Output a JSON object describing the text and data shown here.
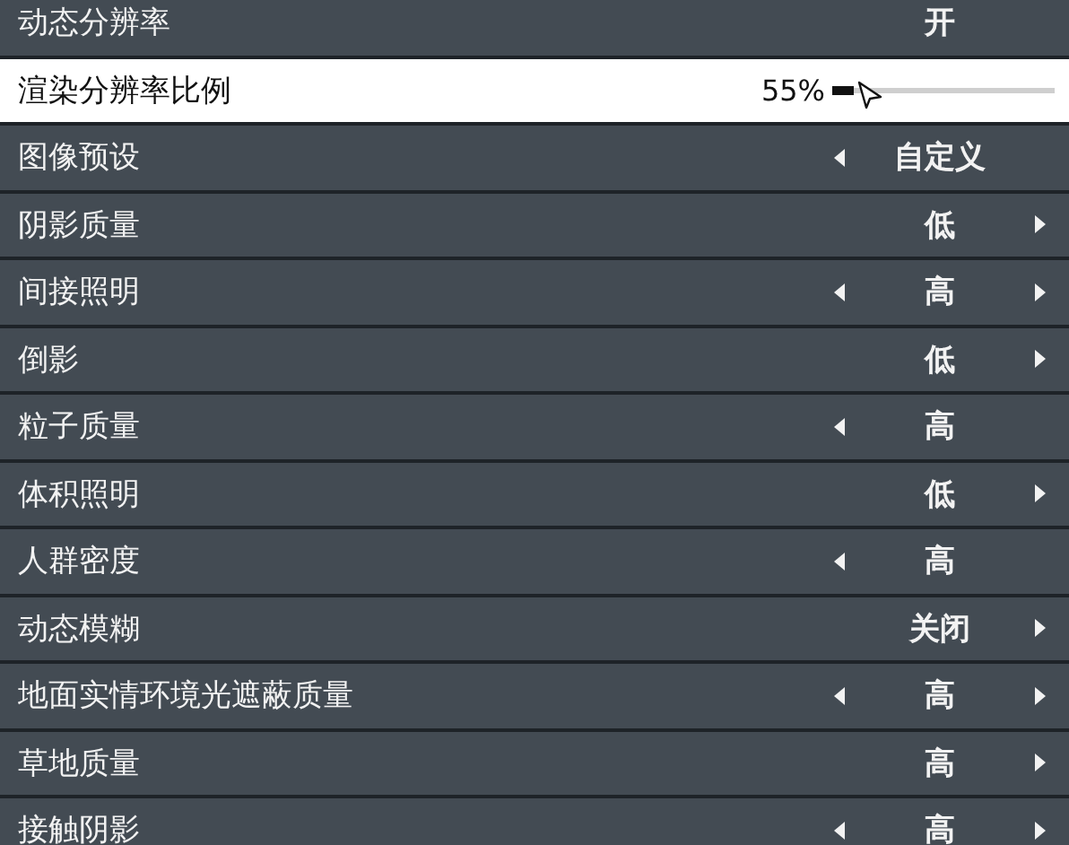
{
  "settings": [
    {
      "kind": "choice",
      "label": "动态分辨率",
      "value": "开",
      "selected": false,
      "left_arrow": false,
      "right_arrow": false
    },
    {
      "kind": "slider",
      "label": "渲染分辨率比例",
      "reading": "55%",
      "level": 0.1,
      "selected": true
    },
    {
      "kind": "choice",
      "label": "图像预设",
      "value": "自定义",
      "selected": false,
      "left_arrow": true,
      "right_arrow": false
    },
    {
      "kind": "choice",
      "label": "阴影质量",
      "value": "低",
      "selected": false,
      "left_arrow": false,
      "right_arrow": true
    },
    {
      "kind": "choice",
      "label": "间接照明",
      "value": "高",
      "selected": false,
      "left_arrow": true,
      "right_arrow": true
    },
    {
      "kind": "choice",
      "label": "倒影",
      "value": "低",
      "selected": false,
      "left_arrow": false,
      "right_arrow": true
    },
    {
      "kind": "choice",
      "label": "粒子质量",
      "value": "高",
      "selected": false,
      "left_arrow": true,
      "right_arrow": false
    },
    {
      "kind": "choice",
      "label": "体积照明",
      "value": "低",
      "selected": false,
      "left_arrow": false,
      "right_arrow": true
    },
    {
      "kind": "choice",
      "label": "人群密度",
      "value": "高",
      "selected": false,
      "left_arrow": true,
      "right_arrow": false
    },
    {
      "kind": "choice",
      "label": "动态模糊",
      "value": "关闭",
      "selected": false,
      "left_arrow": false,
      "right_arrow": true
    },
    {
      "kind": "choice",
      "label": "地面实情环境光遮蔽质量",
      "value": "高",
      "selected": false,
      "left_arrow": true,
      "right_arrow": true
    },
    {
      "kind": "choice",
      "label": "草地质量",
      "value": "高",
      "selected": false,
      "left_arrow": false,
      "right_arrow": true
    },
    {
      "kind": "choice",
      "label": "接触阴影",
      "value": "高",
      "selected": false,
      "left_arrow": true,
      "right_arrow": true
    }
  ]
}
